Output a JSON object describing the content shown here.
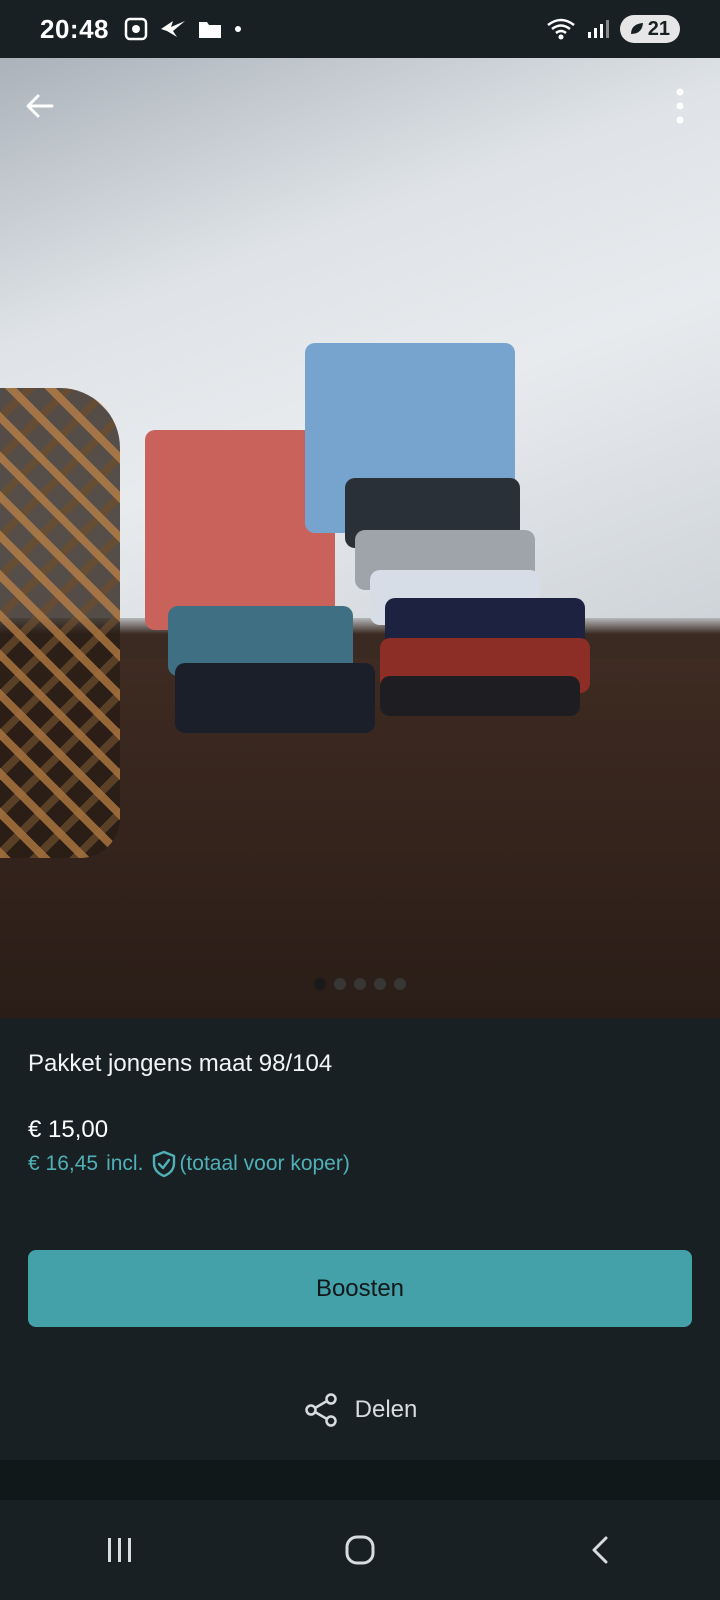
{
  "status_bar": {
    "time": "20:48",
    "battery": "21",
    "icons": [
      "screenshot-icon",
      "wing-icon",
      "folder-icon",
      "dot-icon",
      "wifi-icon",
      "signal-icon",
      "battery-icon"
    ]
  },
  "gallery": {
    "image_count": 5,
    "active_index": 0
  },
  "listing": {
    "title": "Pakket jongens maat 98/104",
    "price": "€ 15,00",
    "price_incl_amount": "€ 16,45",
    "price_incl_label": "incl.",
    "price_incl_note": "(totaal voor koper)"
  },
  "actions": {
    "boost_label": "Boosten",
    "share_label": "Delen"
  },
  "colors": {
    "background": "#192023",
    "accent": "#44a1aa",
    "accent_text": "#4fb0b7"
  }
}
